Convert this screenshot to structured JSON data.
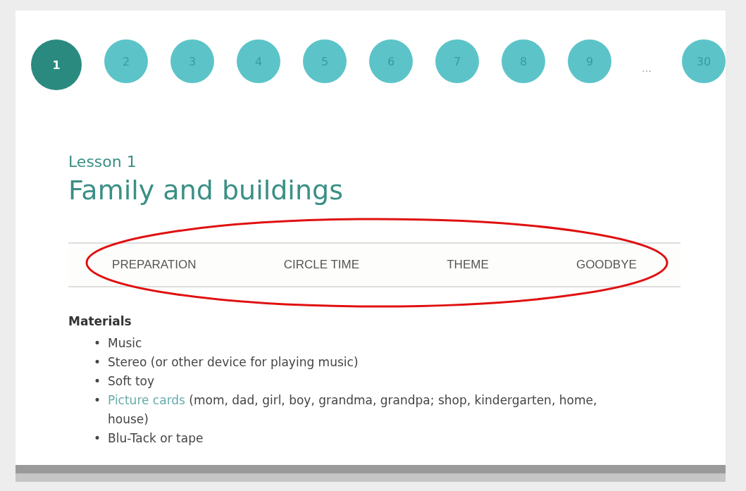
{
  "pagination": {
    "pages": [
      {
        "label": "1",
        "selected": true
      },
      {
        "label": "2",
        "selected": false
      },
      {
        "label": "3",
        "selected": false
      },
      {
        "label": "4",
        "selected": false
      },
      {
        "label": "5",
        "selected": false
      },
      {
        "label": "6",
        "selected": false
      },
      {
        "label": "7",
        "selected": false
      },
      {
        "label": "8",
        "selected": false
      },
      {
        "label": "9",
        "selected": false
      },
      {
        "label": "…",
        "kind": "gap"
      },
      {
        "label": "30",
        "selected": false
      }
    ]
  },
  "lesson": {
    "label": "Lesson 1",
    "title": "Family and buildings"
  },
  "tabs": [
    {
      "label": "PREPARATION",
      "selected": false
    },
    {
      "label": "CIRCLE TIME",
      "selected": false
    },
    {
      "label": "THEME",
      "selected": false
    },
    {
      "label": "GOODBYE",
      "selected": false
    }
  ],
  "materials": {
    "heading": "Materials",
    "bullet": "•",
    "items": [
      {
        "text": "Music"
      },
      {
        "text": "Stereo (or other device for playing music)"
      },
      {
        "text": "Soft toy"
      },
      {
        "link": "Picture cards",
        "text": " (mom, dad, girl, boy, grandma, grandpa; shop, kindergarten, home, house)"
      },
      {
        "text": "Blu-Tack or tape"
      }
    ]
  }
}
